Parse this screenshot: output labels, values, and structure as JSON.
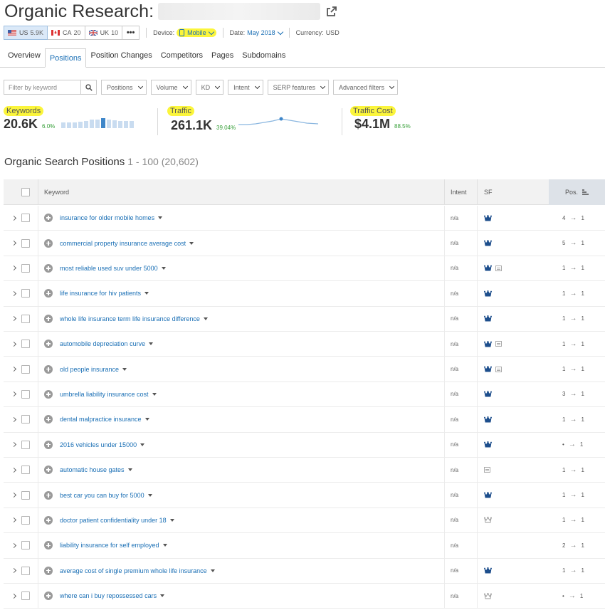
{
  "header": {
    "title": "Organic Research:"
  },
  "databases": [
    {
      "code": "US",
      "count": "5.9K",
      "active": true
    },
    {
      "code": "CA",
      "count": "20",
      "active": false
    },
    {
      "code": "UK",
      "count": "10",
      "active": false
    }
  ],
  "more_label": "•••",
  "device": {
    "label": "Device:",
    "value": "Mobile"
  },
  "date": {
    "label": "Date:",
    "value": "May 2018"
  },
  "currency": {
    "label": "Currency:",
    "value": "USD"
  },
  "tabs": [
    "Overview",
    "Positions",
    "Position Changes",
    "Competitors",
    "Pages",
    "Subdomains"
  ],
  "active_tab": "Positions",
  "filters": {
    "placeholder": "Filter by keyword",
    "dropdowns": [
      "Positions",
      "Volume",
      "KD",
      "Intent",
      "SERP features",
      "Advanced filters"
    ]
  },
  "stats": {
    "keywords": {
      "label": "Keywords",
      "value": "20.6K",
      "change": "6.0%"
    },
    "traffic": {
      "label": "Traffic",
      "value": "261.1K",
      "change": "39.04%"
    },
    "traffic_cost": {
      "label": "Traffic Cost",
      "value": "$4.1M",
      "change": "88.5%"
    }
  },
  "section": {
    "title": "Organic Search Positions",
    "range": "1 - 100 (20,602)"
  },
  "columns": {
    "keyword": "Keyword",
    "intent": "Intent",
    "sf": "SF",
    "pos": "Pos."
  },
  "rows": [
    {
      "keyword": "insurance for older mobile homes",
      "intent": "n/a",
      "sf": [
        "crown"
      ],
      "prev": "4",
      "pos": "1"
    },
    {
      "keyword": "commercial property insurance average cost",
      "intent": "n/a",
      "sf": [
        "crown"
      ],
      "prev": "5",
      "pos": "1"
    },
    {
      "keyword": "most reliable used suv under 5000",
      "intent": "n/a",
      "sf": [
        "crown",
        "image"
      ],
      "prev": "1",
      "pos": "1"
    },
    {
      "keyword": "life insurance for hiv patients",
      "intent": "n/a",
      "sf": [
        "crown"
      ],
      "prev": "1",
      "pos": "1"
    },
    {
      "keyword": "whole life insurance term life insurance difference",
      "intent": "n/a",
      "sf": [
        "crown"
      ],
      "prev": "1",
      "pos": "1"
    },
    {
      "keyword": "automobile depreciation curve",
      "intent": "n/a",
      "sf": [
        "crown",
        "image"
      ],
      "prev": "1",
      "pos": "1"
    },
    {
      "keyword": "old people insurance",
      "intent": "n/a",
      "sf": [
        "crown",
        "image"
      ],
      "prev": "1",
      "pos": "1"
    },
    {
      "keyword": "umbrella liability insurance cost",
      "intent": "n/a",
      "sf": [
        "crown"
      ],
      "prev": "3",
      "pos": "1"
    },
    {
      "keyword": "dental malpractice insurance",
      "intent": "n/a",
      "sf": [
        "crown"
      ],
      "prev": "1",
      "pos": "1"
    },
    {
      "keyword": "2016 vehicles under 15000",
      "intent": "n/a",
      "sf": [
        "crown"
      ],
      "prev": "•",
      "pos": "1"
    },
    {
      "keyword": "automatic house gates",
      "intent": "n/a",
      "sf": [
        "image"
      ],
      "prev": "1",
      "pos": "1"
    },
    {
      "keyword": "best car you can buy for 5000",
      "intent": "n/a",
      "sf": [
        "crown"
      ],
      "prev": "1",
      "pos": "1"
    },
    {
      "keyword": "doctor patient confidentiality under 18",
      "intent": "n/a",
      "sf": [
        "crown-outline"
      ],
      "prev": "1",
      "pos": "1"
    },
    {
      "keyword": "liability insurance for self employed",
      "intent": "n/a",
      "sf": [],
      "prev": "2",
      "pos": "1"
    },
    {
      "keyword": "average cost of single premium whole life insurance",
      "intent": "n/a",
      "sf": [
        "crown"
      ],
      "prev": "1",
      "pos": "1"
    },
    {
      "keyword": "where can i buy repossessed cars",
      "intent": "n/a",
      "sf": [
        "crown-outline"
      ],
      "prev": "•",
      "pos": "1"
    }
  ],
  "colors": {
    "link": "#1a6fb5",
    "highlight": "#fbf53b",
    "positive": "#38a03a",
    "sparkline": "#1a6fb5"
  }
}
